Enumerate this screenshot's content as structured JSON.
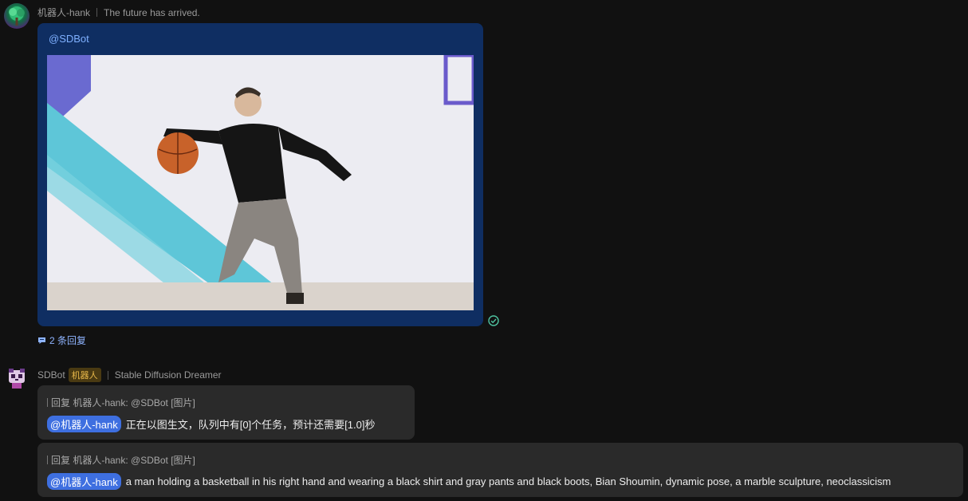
{
  "message1": {
    "author": "机器人-hank",
    "status": "The future has arrived.",
    "mention": "@SDBot",
    "image_alt": "man dribbling a basketball",
    "replies": "2 条回复"
  },
  "message2": {
    "author": "SDBot",
    "badge": "机器人",
    "subtitle": "Stable Diffusion Dreamer",
    "reply1": {
      "quote": "回复 机器人-hank:  @SDBot [图片]",
      "mention": "@机器人-hank",
      "text": "正在以图生文，队列中有[0]个任务，预计还需要[1.0]秒"
    },
    "reply2": {
      "quote": "回复 机器人-hank:  @SDBot [图片]",
      "mention": "@机器人-hank",
      "text": "a man holding a basketball in his right hand and wearing a black shirt and gray pants and black boots, Bian Shoumin, dynamic pose, a marble sculpture, neoclassicism"
    }
  },
  "colors": {
    "background": "#111111",
    "image_bubble": "#0f2e62",
    "reply_bubble": "#2a2a2a",
    "mention_pill": "#3e6fe0",
    "link": "#8fb4ff",
    "badge_text": "#e8b84a"
  },
  "icons": {
    "sent_check": "check-circle-icon",
    "replies": "comment-icon"
  }
}
